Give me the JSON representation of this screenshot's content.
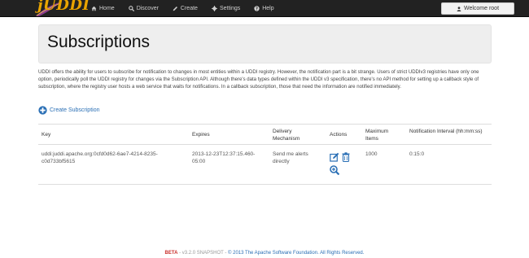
{
  "brand": {
    "name": "jUDDI"
  },
  "nav": {
    "items": [
      {
        "label": "Home",
        "icon": "home-icon"
      },
      {
        "label": "Discover",
        "icon": "search-icon"
      },
      {
        "label": "Create",
        "icon": "pencil-icon"
      },
      {
        "label": "Settings",
        "icon": "gear-icon"
      },
      {
        "label": "Help",
        "icon": "question-icon"
      }
    ],
    "user_label": "Welcome root"
  },
  "page": {
    "title": "Subscriptions",
    "intro": "UDDI offers the ability for users to subscribe for notification to changes in most entities within a UDDI registry. However, the notification part is a bit strange. Users of strict UDDIv3 registries have only one option, periodically poll the UDDI registry for changes via the Subscription API. Although there's data types defined within the UDDI v3 specification, there's no API method for setting up a callback style of subscription, where the registry user hosts a web service that waits for notifications. In a callback subscription, those that need the information are notified immediately.",
    "create_label": "Create Subscription"
  },
  "table": {
    "headers": {
      "key": "Key",
      "expires": "Expires",
      "delivery": "Delivery Mechanism",
      "actions": "Actions",
      "max_items": "Maximum Items",
      "interval": "Notification Interval (hh:mm:ss)"
    },
    "rows": [
      {
        "key": "uddi:juddi.apache.org:0cfd0d62-6ae7-4214-8235-c0d733bf5615",
        "expires": "2013-12-23T12:37:15.460-05:00",
        "delivery": "Send me alerts directly",
        "max_items": "1000",
        "interval": "0:15:0"
      }
    ]
  },
  "footer": {
    "beta": "BETA",
    "version": " - v3.2.0 SNAPSHOT - ",
    "copyright": "© 2013 The Apache Software Foundation. All Rights Reserved."
  },
  "colors": {
    "navbar": "#222222",
    "link": "#2a6fb5",
    "beta": "#c9302c",
    "brand": "#e9a400"
  }
}
